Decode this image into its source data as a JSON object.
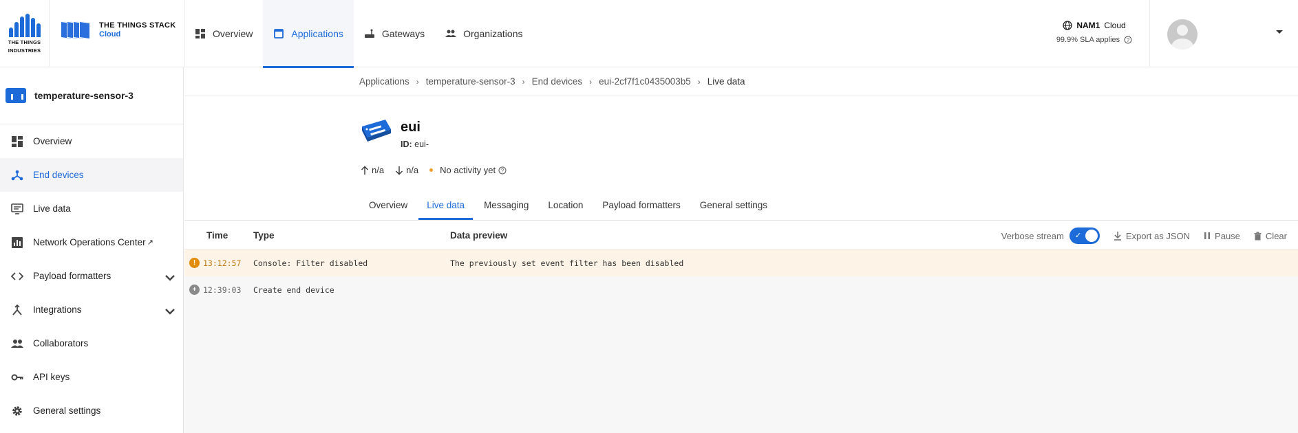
{
  "brand": {
    "tti_line1": "THE THINGS",
    "tti_line2": "INDUSTRIES",
    "tts_line1": "THE THINGS STACK",
    "tts_line2": "Cloud",
    "primary_color": "#1c6bd9"
  },
  "nav": [
    {
      "label": "Overview",
      "icon": "overview-icon"
    },
    {
      "label": "Applications",
      "icon": "applications-icon",
      "active": true
    },
    {
      "label": "Gateways",
      "icon": "gateway-icon"
    },
    {
      "label": "Organizations",
      "icon": "organizations-icon"
    }
  ],
  "cluster": {
    "name": "NAM1",
    "suffix": "Cloud",
    "sla": "99.9% SLA applies"
  },
  "sidebar": {
    "app_name": "temperature-sensor-3",
    "items": [
      {
        "label": "Overview",
        "icon": "overview-icon"
      },
      {
        "label": "End devices",
        "icon": "end-devices-icon",
        "active": true
      },
      {
        "label": "Live data",
        "icon": "live-data-icon"
      },
      {
        "label": "Network Operations Center",
        "icon": "chart-icon",
        "external": true
      },
      {
        "label": "Payload formatters",
        "icon": "code-icon",
        "expandable": true
      },
      {
        "label": "Integrations",
        "icon": "integrations-icon",
        "expandable": true
      },
      {
        "label": "Collaborators",
        "icon": "collaborators-icon"
      },
      {
        "label": "API keys",
        "icon": "key-icon"
      },
      {
        "label": "General settings",
        "icon": "gear-icon"
      }
    ]
  },
  "breadcrumb": [
    "Applications",
    "temperature-sensor-3",
    "End devices",
    "eui-2cf7f1c0435003b5",
    "Live data"
  ],
  "device": {
    "title": "eui",
    "id_label": "ID:",
    "id_value": "eui-",
    "uplink": "n/a",
    "downlink": "n/a",
    "activity": "No activity yet"
  },
  "tabs": [
    "Overview",
    "Live data",
    "Messaging",
    "Location",
    "Payload formatters",
    "General settings"
  ],
  "active_tab": "Live data",
  "events": {
    "headers": {
      "time": "Time",
      "type": "Type",
      "preview": "Data preview"
    },
    "controls": {
      "verbose": "Verbose stream",
      "export": "Export as JSON",
      "pause": "Pause",
      "clear": "Clear"
    },
    "verbose_enabled": true,
    "rows": [
      {
        "time": "13:12:57",
        "type": "Console: Filter disabled",
        "preview": "The previously set event filter has been disabled",
        "kind": "warning"
      },
      {
        "time": "12:39:03",
        "type": "Create end device",
        "preview": "",
        "kind": "create"
      }
    ]
  },
  "colors": {
    "warning": "#e38c0b",
    "warning_bg": "#fdf3e6",
    "create_icon": "#8a8a8a"
  }
}
